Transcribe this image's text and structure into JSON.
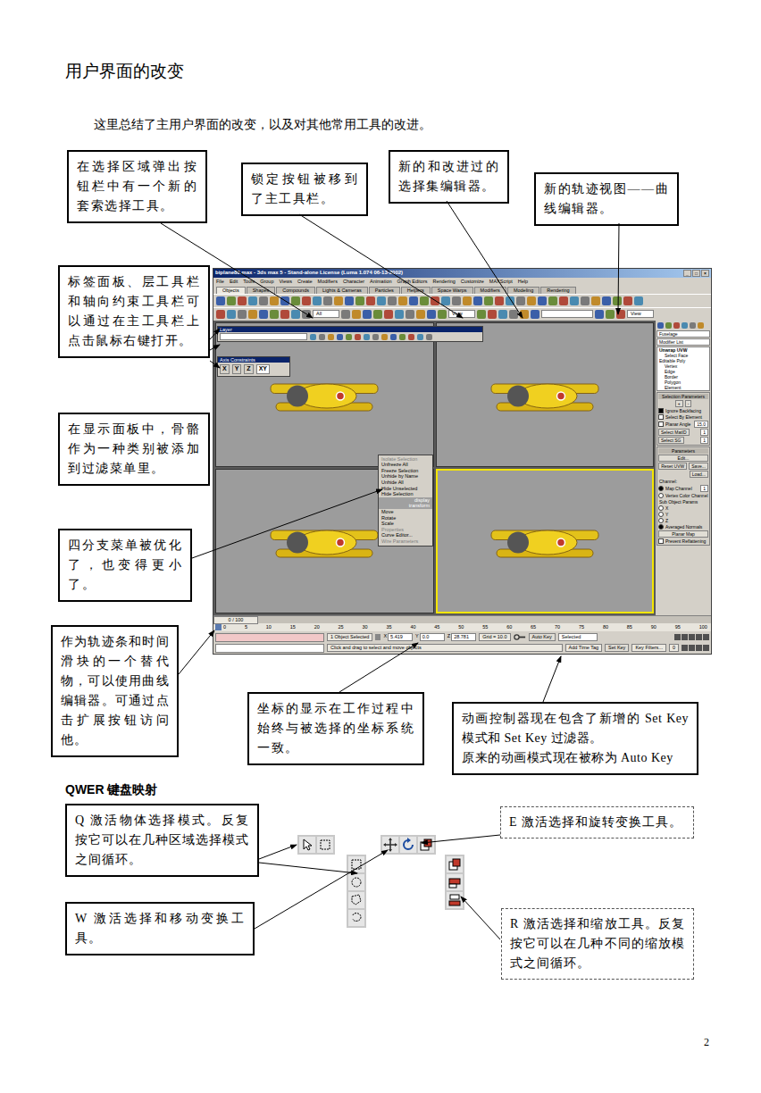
{
  "page": {
    "heading": "用户界面的改变",
    "intro": "这里总结了主用户界面的改变，以及对其他常用工具的改进。",
    "page_number": "2"
  },
  "callouts": [
    {
      "lines": [
        "在选择区域弹出按钮栏中有一个新的套索选择工具。"
      ]
    },
    {
      "lines": [
        "锁定按钮被移到了主工具栏。"
      ]
    },
    {
      "lines": [
        "新的和改进过的选择集编辑器。"
      ]
    },
    {
      "lines": [
        "新的轨迹视图——曲线编辑器。"
      ]
    },
    {
      "lines": [
        "标签面板、层工具栏和轴向约束工具栏可以通过在主工具栏上点击鼠标右键打开。"
      ]
    },
    {
      "lines": [
        "在显示面板中，骨骼作为一种类别被添加到过滤菜单里。"
      ]
    },
    {
      "lines": [
        "四分支菜单被优化了，也变得更小了。"
      ]
    },
    {
      "lines": [
        "作为轨迹条和时间滑块的一个替代物，可以使用曲线编辑器。可通过点击扩展按钮访问他。"
      ]
    },
    {
      "lines": [
        "坐标的显示在工作过程中始终与被选择的坐标系统一致。"
      ]
    },
    {
      "lines": [
        "动画控制器现在包含了新增的 Set Key 模式和 Set Key 过滤器。",
        "原来的动画模式现在被称为 Auto Key"
      ]
    }
  ],
  "screenshot": {
    "title": "biplane80.max - 3ds max 5 - Stand-alone License (Luma 1.074 06-13-2002)",
    "window_controls": [
      "_",
      "□",
      "×"
    ],
    "menu": [
      "File",
      "Edit",
      "Tools",
      "Group",
      "Views",
      "Create",
      "Modifiers",
      "Character",
      "Animation",
      "Graph Editors",
      "Rendering",
      "Customize",
      "MAXScript",
      "Help"
    ],
    "tabs": [
      {
        "label": "Objects",
        "selected": true
      },
      {
        "label": "Shapes",
        "selected": false
      },
      {
        "label": "Compounds",
        "selected": false
      },
      {
        "label": "Lights & Cameras",
        "selected": false
      },
      {
        "label": "Particles",
        "selected": false
      },
      {
        "label": "Helpers",
        "selected": false
      },
      {
        "label": "Space Warps",
        "selected": false
      },
      {
        "label": "Modifiers",
        "selected": false
      },
      {
        "label": "Modeling",
        "selected": false
      },
      {
        "label": "Rendering",
        "selected": false
      }
    ],
    "toolbar": {
      "selection_filter": "All",
      "reference_coord": "View",
      "viewport_menu": "View"
    },
    "layer_toolbar": {
      "title": "Layer"
    },
    "axis_toolbar": {
      "title": "Axis Constraints",
      "buttons": [
        {
          "label": "X",
          "selected": false
        },
        {
          "label": "Y",
          "selected": false
        },
        {
          "label": "Z",
          "selected": false
        },
        {
          "label": "XY",
          "selected": true
        }
      ]
    },
    "viewports": [
      {
        "selected": false
      },
      {
        "selected": false
      },
      {
        "selected": false
      },
      {
        "selected": true
      }
    ],
    "quad_menu": {
      "items": [
        {
          "label": "Isolate Selection",
          "kind": "item",
          "disabled": true
        },
        {
          "label": "Unfreeze All",
          "kind": "item",
          "disabled": false
        },
        {
          "label": "Freeze Selection",
          "kind": "item",
          "disabled": false
        },
        {
          "label": "Unhide by Name",
          "kind": "item",
          "disabled": false
        },
        {
          "label": "Unhide All",
          "kind": "item",
          "disabled": false
        },
        {
          "label": "Hide Unselected",
          "kind": "item",
          "disabled": false
        },
        {
          "label": "Hide Selection",
          "kind": "item",
          "disabled": false
        },
        {
          "label": "display",
          "kind": "header",
          "disabled": false
        },
        {
          "label": "transform",
          "kind": "header",
          "disabled": false
        },
        {
          "label": "Move",
          "kind": "item",
          "disabled": false
        },
        {
          "label": "Rotate",
          "kind": "item",
          "disabled": false
        },
        {
          "label": "Scale",
          "kind": "item",
          "disabled": false
        },
        {
          "label": "Properties",
          "kind": "item",
          "disabled": true
        },
        {
          "label": "Curve Editor...",
          "kind": "item",
          "disabled": false
        },
        {
          "label": "Wire Parameters",
          "kind": "item",
          "disabled": true
        }
      ]
    },
    "command_panel": {
      "object_name": "Fuselage",
      "modifier_list": "Modifier List",
      "stack": [
        {
          "label": "Unwrap UVW",
          "child": false,
          "selected": true
        },
        {
          "label": "Select Face",
          "child": true,
          "selected": false
        },
        {
          "label": "Editable Poly",
          "child": false,
          "selected": false
        },
        {
          "label": "Vertex",
          "child": true,
          "selected": false
        },
        {
          "label": "Edge",
          "child": true,
          "selected": false
        },
        {
          "label": "Border",
          "child": true,
          "selected": false
        },
        {
          "label": "Polygon",
          "child": true,
          "selected": false
        },
        {
          "label": "Element",
          "child": true,
          "selected": false
        }
      ],
      "selection_parameters": {
        "title": "Selection Parameters",
        "buttons": [
          "+",
          "-"
        ],
        "checks": [
          {
            "label": "Ignore Backfacing",
            "checked": true
          },
          {
            "label": "Select By Element",
            "checked": false
          },
          {
            "label": "Planar Angle",
            "checked": false
          }
        ],
        "planar_value": "15.0",
        "fields": [
          {
            "label": "Select MatID",
            "value": "1"
          },
          {
            "label": "Select SG",
            "value": "1"
          }
        ]
      },
      "parameters": {
        "title": "Parameters",
        "edit": "Edit...",
        "row": [
          "Reset UVW",
          "Save..."
        ],
        "load": "Load...",
        "channel_label": "Channel:",
        "channels": [
          {
            "label": "Map Channel",
            "selected": true,
            "value": "1"
          },
          {
            "label": "Vertex Color Channel",
            "selected": false,
            "value": ""
          }
        ],
        "sub_title": "Sub Object Params",
        "axes": [
          {
            "label": "X",
            "selected": false
          },
          {
            "label": "Y",
            "selected": false
          },
          {
            "label": "Z",
            "selected": false
          },
          {
            "label": "Averaged Normals",
            "selected": true
          }
        ],
        "planar_map": "Planar Map",
        "prevent": {
          "label": "Prevent Reflattening",
          "checked": false
        }
      }
    },
    "timeline": {
      "slider": "0 / 100",
      "level": 0,
      "ticks": [
        "0",
        "5",
        "10",
        "15",
        "20",
        "25",
        "30",
        "35",
        "40",
        "45",
        "50",
        "55",
        "60",
        "65",
        "70",
        "75",
        "80",
        "85",
        "90",
        "95",
        "100"
      ]
    },
    "status": {
      "selection": "1 Object Selected",
      "prompt": "Click and drag to select and move objects",
      "coords": [
        {
          "label": "X",
          "value": "5.419"
        },
        {
          "label": "Y",
          "value": "0.0"
        },
        {
          "label": "Z",
          "value": "28.781"
        }
      ],
      "grid": "Grid = 10.0",
      "time_tag": "Add Time Tag",
      "auto_key": "Auto Key",
      "key_mode": "Selected",
      "set_key": "Set Key",
      "key_filters": "Key Filters...",
      "frame": "0"
    }
  },
  "qwer": {
    "heading": "QWER 键盘映射",
    "callouts": [
      {
        "text": "Q 激活物体选择模式。反复按它可以在几种区域选择模式之间循环。",
        "kind": "solid"
      },
      {
        "text": "W 激活选择和移动变换工具。",
        "kind": "solid"
      },
      {
        "text": "E 激活选择和旋转变换工具。",
        "kind": "dashed"
      },
      {
        "text": "R 激活选择和缩放工具。反复按它可以在几种不同的缩放模式之间循环。",
        "kind": "dashed"
      }
    ]
  }
}
